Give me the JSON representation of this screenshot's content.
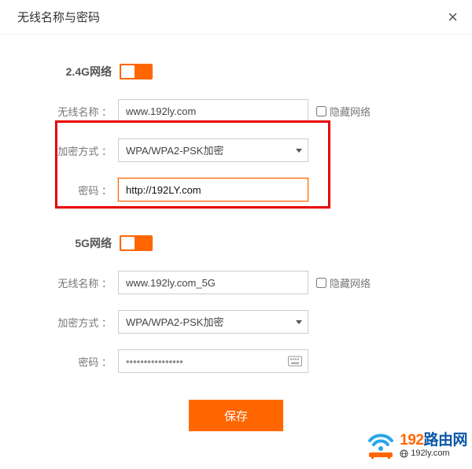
{
  "dialog": {
    "title": "无线名称与密码"
  },
  "labels": {
    "ssid": "无线名称 ：",
    "enc": "加密方式 ：",
    "pwd": "密码 ：",
    "hide": "隐藏网络"
  },
  "band24": {
    "title": "2.4G网络",
    "ssid": "www.192ly.com",
    "enc": "WPA/WPA2-PSK加密",
    "pwd": "http://192LY.com",
    "hide": false
  },
  "band5": {
    "title": "5G网络",
    "ssid": "www.192ly.com_5G",
    "enc": "WPA/WPA2-PSK加密",
    "pwd": "••••••••••••••••",
    "hide": false
  },
  "buttons": {
    "save": "保存"
  },
  "watermark": {
    "main_a": "192",
    "main_b": "路由网",
    "url": "192ly.com"
  },
  "colors": {
    "accent": "#f60",
    "highlight": "#e80000",
    "brand_blue": "#0b57a6"
  }
}
